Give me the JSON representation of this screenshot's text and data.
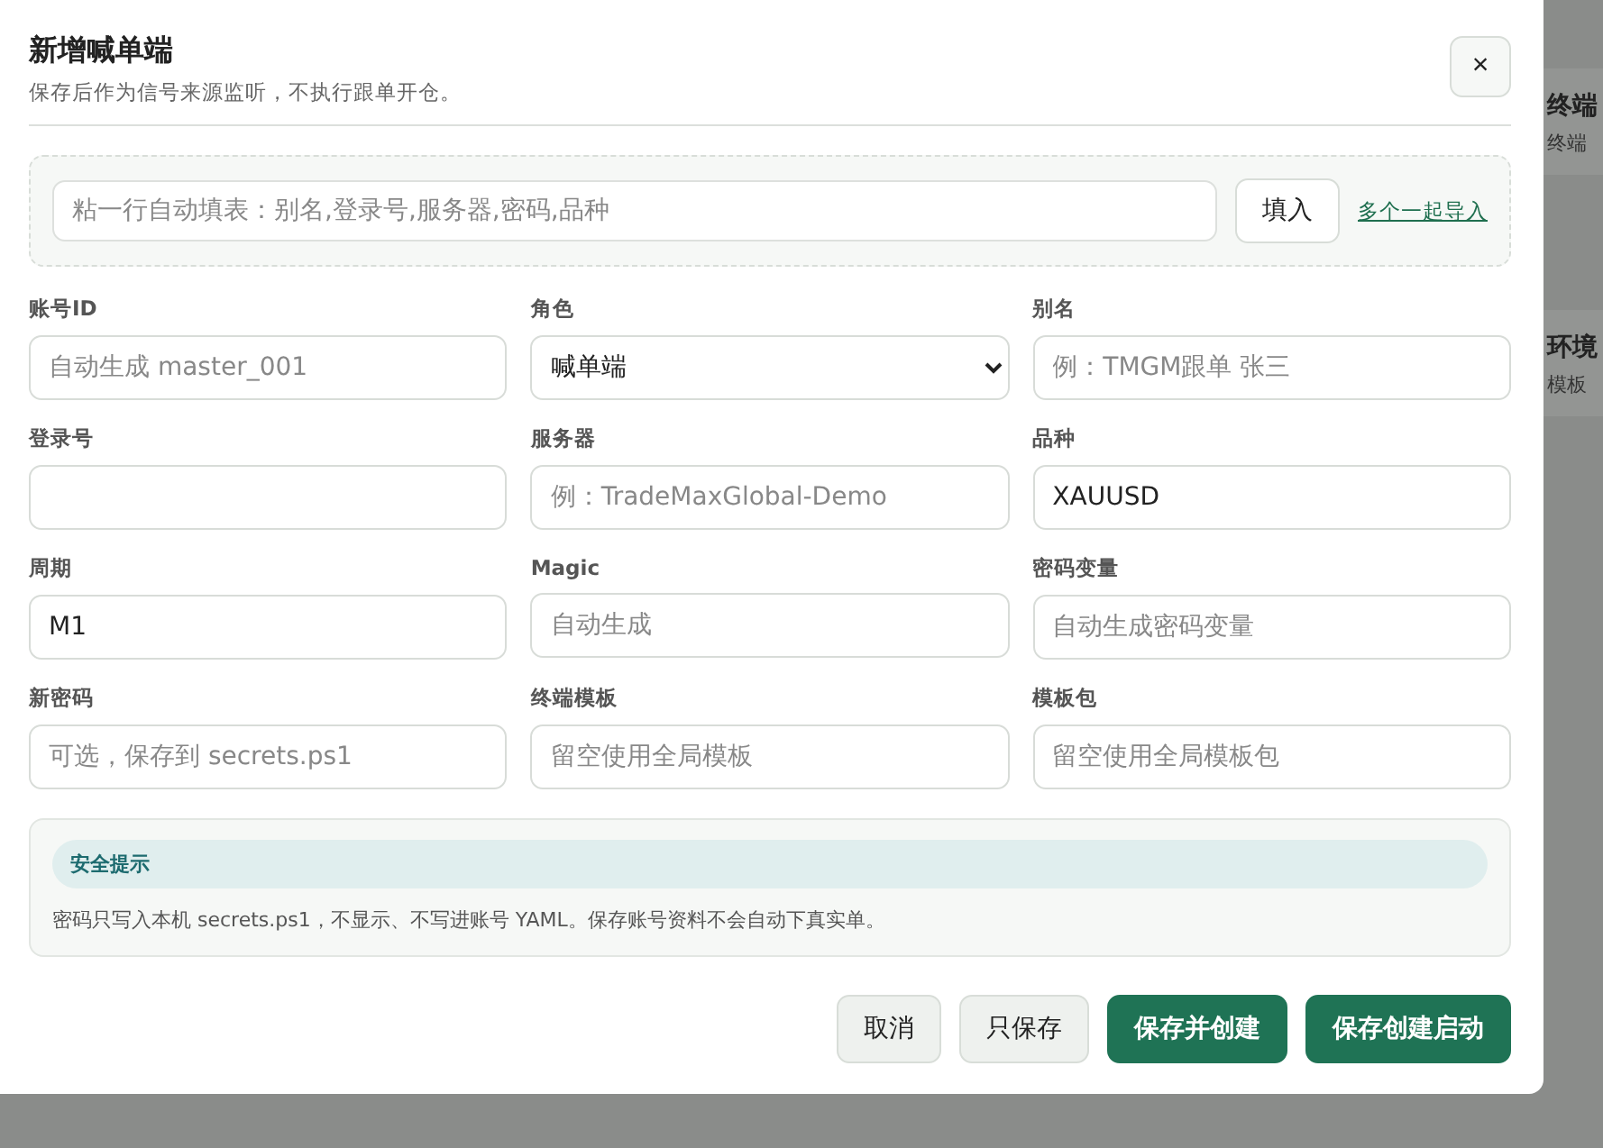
{
  "dialog": {
    "title": "新增喊单端",
    "subtitle": "保存后作为信号来源监听，不执行跟单开仓。",
    "close": "×"
  },
  "quick_fill": {
    "placeholder": "粘一行自动填表：别名,登录号,服务器,密码,品种",
    "button": "填入",
    "link": "多个一起导入"
  },
  "fields": [
    {
      "kind": "input",
      "label": "账号ID",
      "placeholder": "自动生成 master_001"
    },
    {
      "kind": "select",
      "label": "角色",
      "value": "喊单端"
    },
    {
      "kind": "input",
      "label": "别名",
      "placeholder": "例：TMGM跟单 张三"
    },
    {
      "kind": "input",
      "label": "登录号"
    },
    {
      "kind": "input",
      "label": "服务器",
      "placeholder": "例：TradeMaxGlobal-Demo"
    },
    {
      "kind": "input",
      "label": "品种",
      "value": "XAUUSD"
    },
    {
      "kind": "input",
      "label": "周期",
      "value": "M1"
    },
    {
      "kind": "input",
      "label": "Magic",
      "placeholder": "自动生成"
    },
    {
      "kind": "input",
      "label": "密码变量",
      "placeholder": "自动生成密码变量"
    },
    {
      "kind": "input",
      "label": "新密码",
      "placeholder": "可选，保存到 secrets.ps1"
    },
    {
      "kind": "input",
      "label": "终端模板",
      "placeholder": "留空使用全局模板"
    },
    {
      "kind": "input",
      "label": "模板包",
      "placeholder": "留空使用全局模板包"
    }
  ],
  "notice": {
    "title": "安全提示",
    "text": "密码只写入本机 secrets.ps1，不显示、不写进账号 YAML。保存账号资料不会自动下真实单。"
  },
  "buttons": [
    {
      "label": "取消",
      "kind": "secondary"
    },
    {
      "label": "只保存",
      "kind": "secondary"
    },
    {
      "label": "保存并创建",
      "kind": "primary"
    },
    {
      "label": "保存创建启动",
      "kind": "primary"
    }
  ],
  "background_cards": [
    {
      "title": "终端",
      "text": "终端"
    },
    {
      "title": "环境",
      "text": "模板"
    }
  ]
}
